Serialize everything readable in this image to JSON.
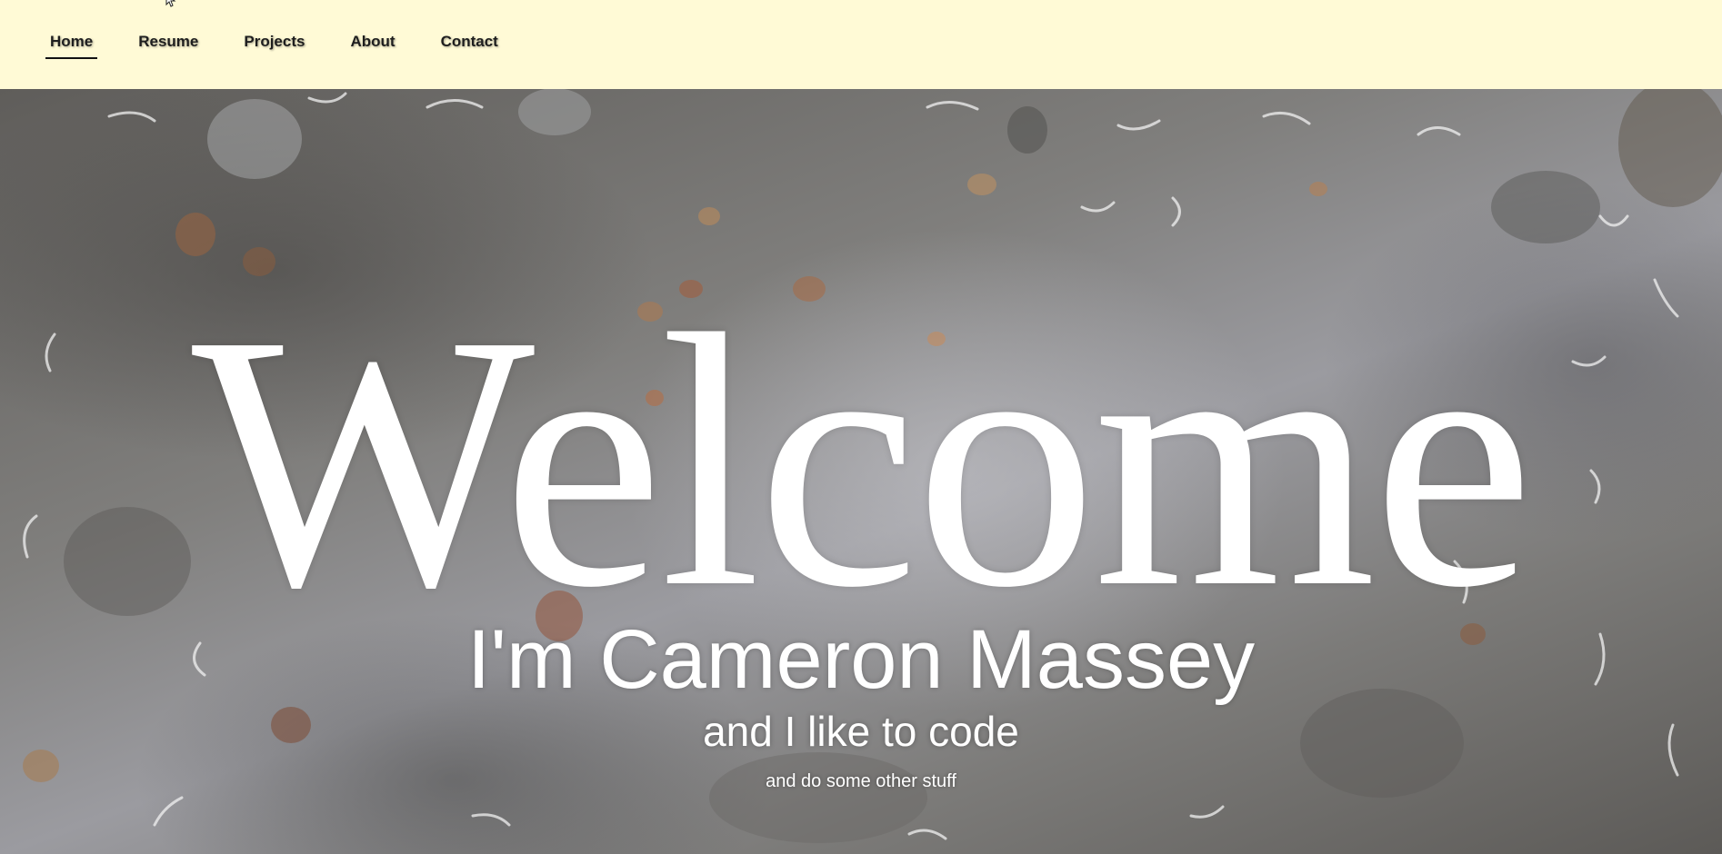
{
  "nav": {
    "items": [
      {
        "label": "Home",
        "active": true
      },
      {
        "label": "Resume",
        "active": false
      },
      {
        "label": "Projects",
        "active": false
      },
      {
        "label": "About",
        "active": false
      },
      {
        "label": "Contact",
        "active": false
      }
    ]
  },
  "hero": {
    "headline": "Welcome",
    "name_line": "I'm Cameron Massey",
    "tagline": "and I like to code",
    "subtagline": "and do some other stuff"
  },
  "colors": {
    "nav_background": "#fffad6",
    "nav_text": "#1e1e1e",
    "hero_text": "#ffffff"
  },
  "icons": {
    "cursor": "mouse-pointer-icon"
  }
}
